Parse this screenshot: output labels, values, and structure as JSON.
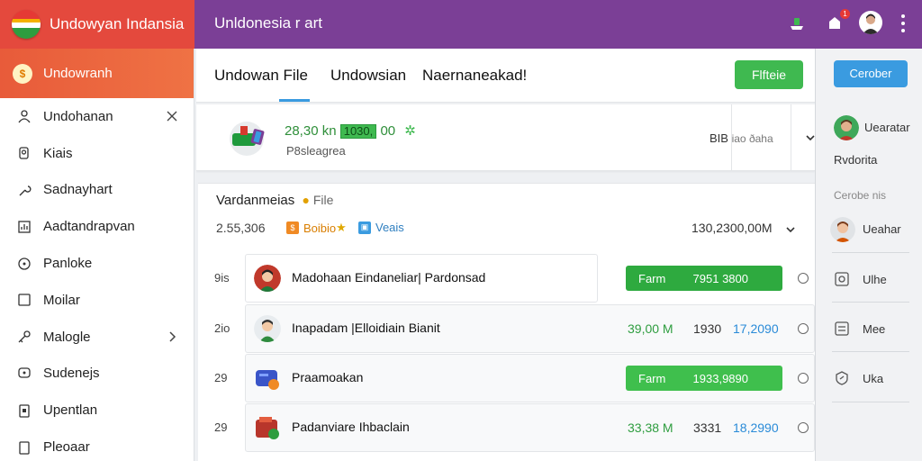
{
  "brand": {
    "title": "Undowyan Indansia"
  },
  "topbar": {
    "title": "Unldonesia r art",
    "notification_count": "1"
  },
  "sidebar": {
    "active": {
      "label": "Undowranh"
    },
    "items": [
      {
        "label": "Undohanan",
        "icon": "user-icon",
        "trail": "close-icon"
      },
      {
        "label": "Kiais",
        "icon": "person-icon"
      },
      {
        "label": "Sadnayhart",
        "icon": "wrench-icon"
      },
      {
        "label": "Aadtandrapvan",
        "icon": "chart-icon"
      },
      {
        "label": "Panloke",
        "icon": "circle-icon"
      },
      {
        "label": "Moilar",
        "icon": "square-icon"
      },
      {
        "label": "Malogle",
        "icon": "key-icon",
        "trail": "chevron-right-icon"
      },
      {
        "label": "Sudenejs",
        "icon": "chat-icon"
      },
      {
        "label": "Upentlan",
        "icon": "clipboard-icon"
      },
      {
        "label": "Pleoaar",
        "icon": "document-icon"
      }
    ]
  },
  "tabs": [
    {
      "label": "Undowan File"
    },
    {
      "label": "Undowsian"
    },
    {
      "label": "Naernaneakad!"
    }
  ],
  "main": {
    "green_button": "Flfteie"
  },
  "summary": {
    "amount": "28,30 kn",
    "tag": "1030,",
    "amount_tail": "00",
    "sub": "P8sleagrea",
    "right_main": "BIB",
    "right_small": "iao ðaha"
  },
  "card": {
    "title": "Vardanmeias",
    "title_sub": "File",
    "meta": "2.55,306",
    "chip1": "Boibio",
    "chip2": "Veais",
    "total": "130,2300,00M"
  },
  "rows": [
    {
      "num": "9is",
      "label": "Madohaan  Eindaneliar| Pardonsad",
      "type": "pill",
      "pill_left": "Farm",
      "pill_right": "7951 3800"
    },
    {
      "num": "2io",
      "label": "Inapadam |Elloidiain Bianit",
      "type": "amounts",
      "amt_green": "39,00 M",
      "amt_plain": "1930",
      "amt_blue": "17,2090"
    },
    {
      "num": "29",
      "label": "Praamoakan",
      "type": "pill",
      "pill_left": "Farm",
      "pill_right": "1933,9890"
    },
    {
      "num": "29",
      "label": "Padanviare Ihbaclain",
      "type": "amounts",
      "amt_green": "33,38 M",
      "amt_plain": "3331",
      "amt_blue": "18,2990"
    }
  ],
  "right_panel": {
    "button": "Cerober",
    "user1": "Uearatar",
    "user1_sub": "Rvdorita",
    "section": "Cerobe nis",
    "user2": "Ueahar",
    "items": [
      {
        "label": "Ulhe"
      },
      {
        "label": "Mee"
      },
      {
        "label": "Uka"
      }
    ]
  },
  "colors": {
    "brand": "#e4493d",
    "topbar": "#7b3f96",
    "green": "#3fb950",
    "blue": "#3a9be0"
  }
}
